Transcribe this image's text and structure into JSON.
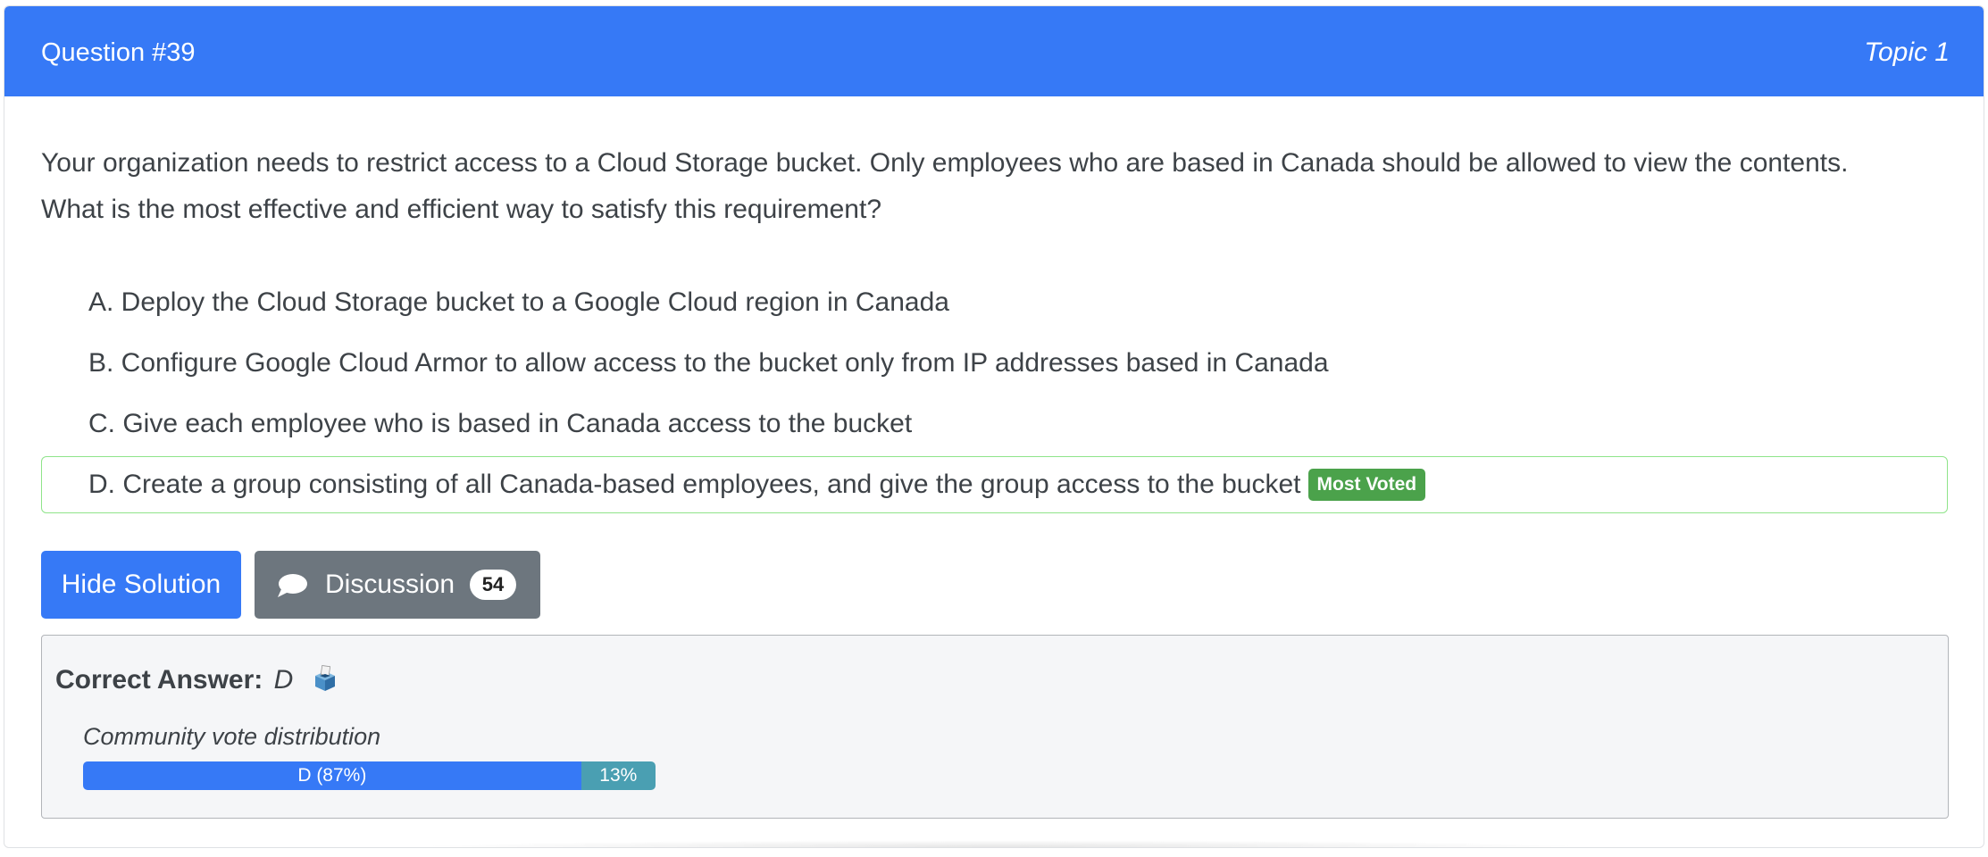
{
  "header": {
    "question_number": "Question #39",
    "topic": "Topic 1"
  },
  "question": {
    "line1": "Your organization needs to restrict access to a Cloud Storage bucket. Only employees who are based in Canada should be allowed to view the contents.",
    "line2": "What is the most effective and efficient way to satisfy this requirement?"
  },
  "choices": [
    {
      "text": "A. Deploy the Cloud Storage bucket to a Google Cloud region in Canada"
    },
    {
      "text": "B. Configure Google Cloud Armor to allow access to the bucket only from IP addresses based in Canada"
    },
    {
      "text": "C. Give each employee who is based in Canada access to the bucket"
    },
    {
      "text": "D. Create a group consisting of all Canada-based employees, and give the group access to the bucket",
      "badge": "Most Voted"
    }
  ],
  "buttons": {
    "hide_solution": "Hide Solution",
    "discussion": "Discussion",
    "discussion_count": "54"
  },
  "answer": {
    "label": "Correct Answer:",
    "value": "D",
    "icon": "ballot-box-icon"
  },
  "vote": {
    "title": "Community vote distribution",
    "segments": [
      {
        "label": "D (87%)",
        "percent": 87,
        "color": "#3679f6"
      },
      {
        "label": "13%",
        "percent": 13,
        "color": "#4a9fb2"
      }
    ]
  },
  "colors": {
    "primary": "#3679f6",
    "secondary_button": "#6d767e",
    "badge_green": "#4ba24b",
    "highlight_border": "#8fe48a"
  }
}
